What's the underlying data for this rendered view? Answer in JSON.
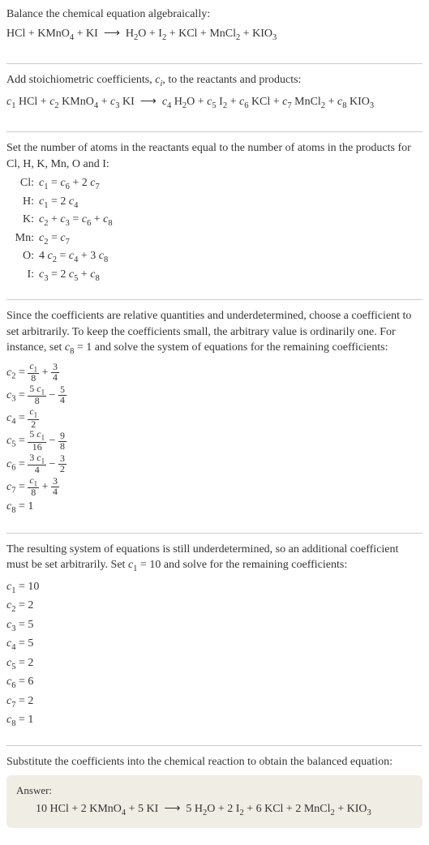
{
  "title": "Balance the chemical equation algebraically:",
  "mainEquation": "HCl + KMnO₄ + KI ⟶ H₂O + I₂ + KCl + MnCl₂ + KIO₃",
  "stoichText": "Add stoichiometric coefficients, cᵢ, to the reactants and products:",
  "stoichEquation": "c₁ HCl + c₂ KMnO₄ + c₃ KI ⟶ c₄ H₂O + c₅ I₂ + c₆ KCl + c₇ MnCl₂ + c₈ KIO₃",
  "atomIntro": "Set the number of atoms in the reactants equal to the number of atoms in the products for Cl, H, K, Mn, O and I:",
  "atoms": [
    {
      "el": "Cl:",
      "eq": "c₁ = c₆ + 2 c₇"
    },
    {
      "el": "H:",
      "eq": "c₁ = 2 c₄"
    },
    {
      "el": "K:",
      "eq": "c₂ + c₃ = c₆ + c₈"
    },
    {
      "el": "Mn:",
      "eq": "c₂ = c₇"
    },
    {
      "el": "O:",
      "eq": "4 c₂ = c₄ + 3 c₈"
    },
    {
      "el": "I:",
      "eq": "c₃ = 2 c₅ + c₈"
    }
  ],
  "underdetText": "Since the coefficients are relative quantities and underdetermined, choose a coefficient to set arbitrarily. To keep the coefficients small, the arbitrary value is ordinarily one. For instance, set c₈ = 1 and solve the system of equations for the remaining coefficients:",
  "fracCoeffs": [
    {
      "lhs": "c₂ =",
      "num": "c₁",
      "den": "8",
      "tail": " + ",
      "num2": "3",
      "den2": "4"
    },
    {
      "lhs": "c₃ =",
      "num": "5 c₁",
      "den": "8",
      "tail": " − ",
      "num2": "5",
      "den2": "4"
    },
    {
      "lhs": "c₄ =",
      "num": "c₁",
      "den": "2",
      "tail": "",
      "num2": "",
      "den2": ""
    },
    {
      "lhs": "c₅ =",
      "num": "5 c₁",
      "den": "16",
      "tail": " − ",
      "num2": "9",
      "den2": "8"
    },
    {
      "lhs": "c₆ =",
      "num": "3 c₁",
      "den": "4",
      "tail": " − ",
      "num2": "3",
      "den2": "2"
    },
    {
      "lhs": "c₇ =",
      "num": "c₁",
      "den": "8",
      "tail": " + ",
      "num2": "3",
      "den2": "4"
    }
  ],
  "c8line": "c₈ = 1",
  "underdet2Text": "The resulting system of equations is still underdetermined, so an additional coefficient must be set arbitrarily. Set c₁ = 10 and solve for the remaining coefficients:",
  "finalCoeffs": [
    "c₁ = 10",
    "c₂ = 2",
    "c₃ = 5",
    "c₄ = 5",
    "c₅ = 2",
    "c₆ = 6",
    "c₇ = 2",
    "c₈ = 1"
  ],
  "substituteText": "Substitute the coefficients into the chemical reaction to obtain the balanced equation:",
  "answerLabel": "Answer:",
  "answerEquation": "10 HCl + 2 KMnO₄ + 5 KI ⟶ 5 H₂O + 2 I₂ + 6 KCl + 2 MnCl₂ + KIO₃"
}
